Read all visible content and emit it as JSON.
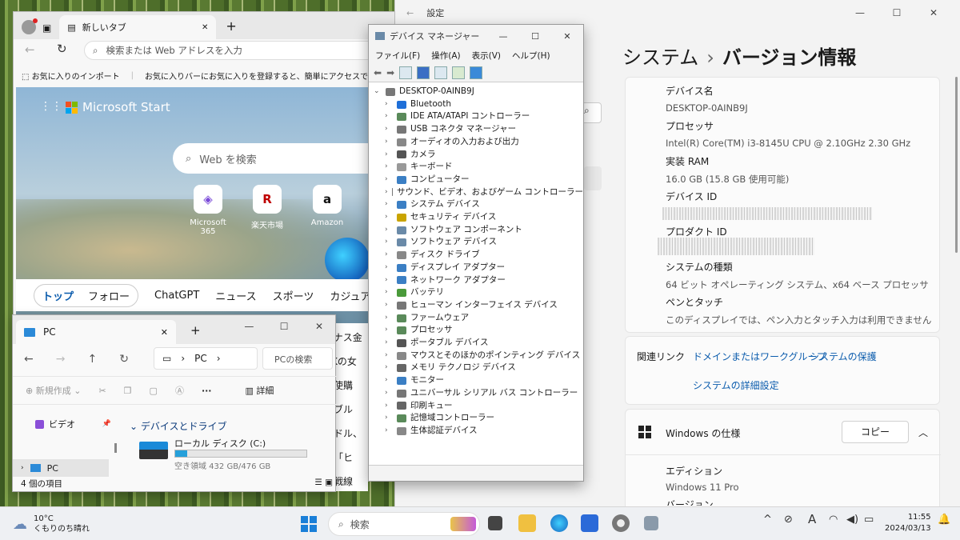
{
  "settings": {
    "title": "設定",
    "breadcrumb_parent": "システム",
    "breadcrumb_sep": "›",
    "breadcrumb_current": "バージョン情報",
    "specs": [
      {
        "label": "デバイス名",
        "value": "DESKTOP-0AINB9J"
      },
      {
        "label": "プロセッサ",
        "value": "Intel(R) Core(TM) i3-8145U CPU @ 2.10GHz   2.30 GHz"
      },
      {
        "label": "実装 RAM",
        "value": "16.0 GB (15.8 GB 使用可能)"
      },
      {
        "label": "デバイス ID",
        "value": ""
      },
      {
        "label": "プロダクト ID",
        "value": ""
      },
      {
        "label": "システムの種類",
        "value": "64 ビット オペレーティング システム、x64 ベース プロセッサ"
      },
      {
        "label": "ペンとタッチ",
        "value": "このディスプレイでは、ペン入力とタッチ入力は利用できません"
      }
    ],
    "related_label": "関連リンク",
    "related_links": [
      "ドメインまたはワークグループ",
      "システムの保護",
      "システムの詳細設定"
    ],
    "windows_spec_title": "Windows の仕様",
    "copy_button": "コピー",
    "edition_label": "エディション",
    "edition_value": "Windows 11 Pro",
    "version_label": "バージョン"
  },
  "edge": {
    "tab_title": "新しいタブ",
    "address_placeholder": "検索または Web アドレスを入力",
    "fav_import": "お気に入りのインポート",
    "fav_hint": "お気に入りバーにお気に入りを登録すると、簡単にアクセスできるようにな",
    "brand": "Microsoft Start",
    "web_search_placeholder": "Web を検索",
    "tiles": [
      {
        "label": "Microsoft 365",
        "glyph": "◈",
        "color": "#7a4ad8"
      },
      {
        "label": "楽天市場",
        "glyph": "R",
        "color": "#bf0000"
      },
      {
        "label": "Amazon",
        "glyph": "a",
        "color": "#111111"
      }
    ],
    "nav_items": [
      "トップ",
      "フォロー",
      "ChatGPT",
      "ニュース",
      "スポーツ",
      "カジュアル"
    ],
    "headline_fragments": [
      "イナス金",
      "HKの女",
      "性使購",
      "ラブル",
      "イドル、",
      "替「ヒ",
      "部戦線"
    ]
  },
  "explorer": {
    "tab_title": "PC",
    "path": "PC",
    "search_placeholder": "PCの検索",
    "cmd_new": "新規作成",
    "cmd_details": "詳細",
    "side_items": [
      "ビデオ",
      "PC"
    ],
    "section": "デバイスとドライブ",
    "drive_name": "ローカル ディスク (C:)",
    "drive_free": "空き領域 432 GB/476 GB",
    "drive_used_fraction": 0.09,
    "status_count": "4 個の項目"
  },
  "devmgr": {
    "title": "デバイス マネージャー",
    "menu": [
      "ファイル(F)",
      "操作(A)",
      "表示(V)",
      "ヘルプ(H)"
    ],
    "root": "DESKTOP-0AINB9J",
    "nodes": [
      {
        "label": "Bluetooth",
        "color": "#1f6fd8"
      },
      {
        "label": "IDE ATA/ATAPI コントローラー",
        "color": "#5a8a5a"
      },
      {
        "label": "USB コネクタ マネージャー",
        "color": "#777777"
      },
      {
        "label": "オーディオの入力および出力",
        "color": "#888888"
      },
      {
        "label": "カメラ",
        "color": "#555555"
      },
      {
        "label": "キーボード",
        "color": "#999999"
      },
      {
        "label": "コンピューター",
        "color": "#3b7fc4"
      },
      {
        "label": "サウンド、ビデオ、およびゲーム コントローラー",
        "color": "#777777"
      },
      {
        "label": "システム デバイス",
        "color": "#3b7fc4"
      },
      {
        "label": "セキュリティ デバイス",
        "color": "#c9a400"
      },
      {
        "label": "ソフトウェア コンポーネント",
        "color": "#6a8aa8"
      },
      {
        "label": "ソフトウェア デバイス",
        "color": "#6a8aa8"
      },
      {
        "label": "ディスク ドライブ",
        "color": "#888888"
      },
      {
        "label": "ディスプレイ アダプター",
        "color": "#3b7fc4"
      },
      {
        "label": "ネットワーク アダプター",
        "color": "#3b7fc4"
      },
      {
        "label": "バッテリ",
        "color": "#4a9a3a"
      },
      {
        "label": "ヒューマン インターフェイス デバイス",
        "color": "#777777"
      },
      {
        "label": "ファームウェア",
        "color": "#5a8a5a"
      },
      {
        "label": "プロセッサ",
        "color": "#5a8a5a"
      },
      {
        "label": "ポータブル デバイス",
        "color": "#555555"
      },
      {
        "label": "マウスとそのほかのポインティング デバイス",
        "color": "#888888"
      },
      {
        "label": "メモリ テクノロジ デバイス",
        "color": "#666666"
      },
      {
        "label": "モニター",
        "color": "#3b7fc4"
      },
      {
        "label": "ユニバーサル シリアル バス コントローラー",
        "color": "#777777"
      },
      {
        "label": "印刷キュー",
        "color": "#666666"
      },
      {
        "label": "記憶域コントローラー",
        "color": "#5a8a5a"
      },
      {
        "label": "生体認証デバイス",
        "color": "#888888"
      }
    ]
  },
  "taskbar": {
    "weather_temp": "10°C",
    "weather_desc": "くもりのち晴れ",
    "search_placeholder": "検索",
    "ime": "A",
    "time": "11:55",
    "date": "2024/03/13"
  }
}
